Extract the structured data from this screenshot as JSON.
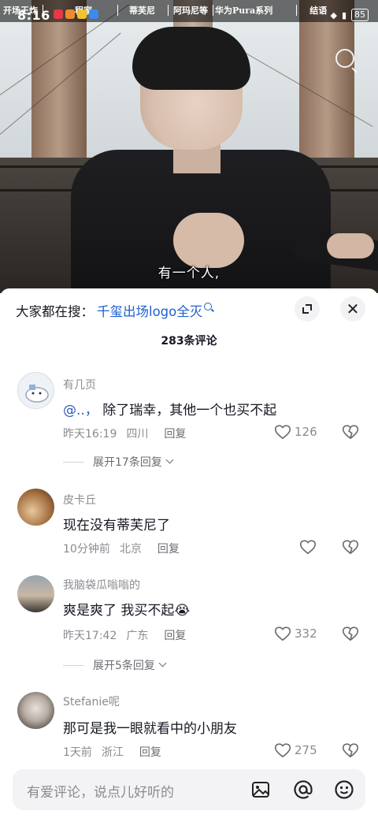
{
  "status_bar": {
    "time": "8:16",
    "ticker_items": [
      "开场王炸",
      "程家",
      "蒂芙尼",
      "阿玛尼等",
      "华为Pura系列",
      "结语"
    ],
    "battery": "85"
  },
  "video": {
    "subtitle": "有一个人,"
  },
  "comments_panel": {
    "search_prefix": "大家都在搜：",
    "search_term": "千玺出场logo全灭",
    "comment_count": "283条评论"
  },
  "comments": [
    {
      "username": "有几页",
      "mention": "@..，",
      "text": " 除了瑞幸，其他一个也买不起",
      "time": "昨天16:19",
      "location": "四川",
      "reply_label": "回复",
      "likes": "126",
      "expand_label": "展开17条回复"
    },
    {
      "username": "皮卡丘",
      "text": "现在没有蒂芙尼了",
      "time": "10分钟前",
      "location": "北京",
      "reply_label": "回复",
      "likes": ""
    },
    {
      "username": "我脑袋瓜嗡嗡的",
      "text": "爽是爽了  我买不起😭",
      "time": "昨天17:42",
      "location": "广东",
      "reply_label": "回复",
      "likes": "332",
      "expand_label": "展开5条回复"
    },
    {
      "username": "Stefanie呢",
      "text": "那可是我一眼就看中的小朋友",
      "time": "1天前",
      "location": "浙江",
      "reply_label": "回复",
      "likes": "275"
    }
  ],
  "input_bar": {
    "placeholder": "有爱评论，说点儿好听的"
  },
  "colors": {
    "link_blue": "#1f5fd1",
    "meta_gray": "#8a8b91",
    "text_dark": "#161823"
  },
  "icons": [
    "search-icon",
    "expand-icon",
    "close-icon",
    "heart-icon",
    "dislike-icon",
    "chevron-down-icon",
    "image-icon",
    "mention-icon",
    "emoji-icon",
    "camera-search-icon"
  ]
}
